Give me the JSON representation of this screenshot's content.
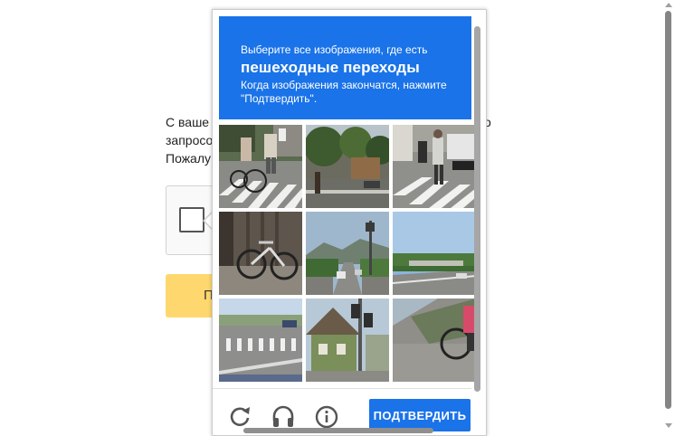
{
  "background": {
    "text_lines": [
      "С ваше",
      "запросо",
      "Пожалу"
    ],
    "text_right": "о",
    "button_label": "П"
  },
  "challenge": {
    "instruction": "Выберите все изображения, где есть",
    "target": "пешеходные переходы",
    "hint": "Когда изображения закончатся, нажмите \"Подтвердить\".",
    "verify_label": "ПОДТВЕРДИТЬ",
    "accent_color": "#1a73e8",
    "tiles": [
      {
        "scene": "crosswalk-cyclist"
      },
      {
        "scene": "street-trees"
      },
      {
        "scene": "crosswalk-pedestrians"
      },
      {
        "scene": "parked-bicycle"
      },
      {
        "scene": "road-traffic-light"
      },
      {
        "scene": "highway-overpass"
      },
      {
        "scene": "intersection-crosswalk"
      },
      {
        "scene": "house-traffic-light"
      },
      {
        "scene": "cyclist-road"
      }
    ],
    "icons": [
      "refresh-icon",
      "headphones-icon",
      "info-icon"
    ]
  }
}
